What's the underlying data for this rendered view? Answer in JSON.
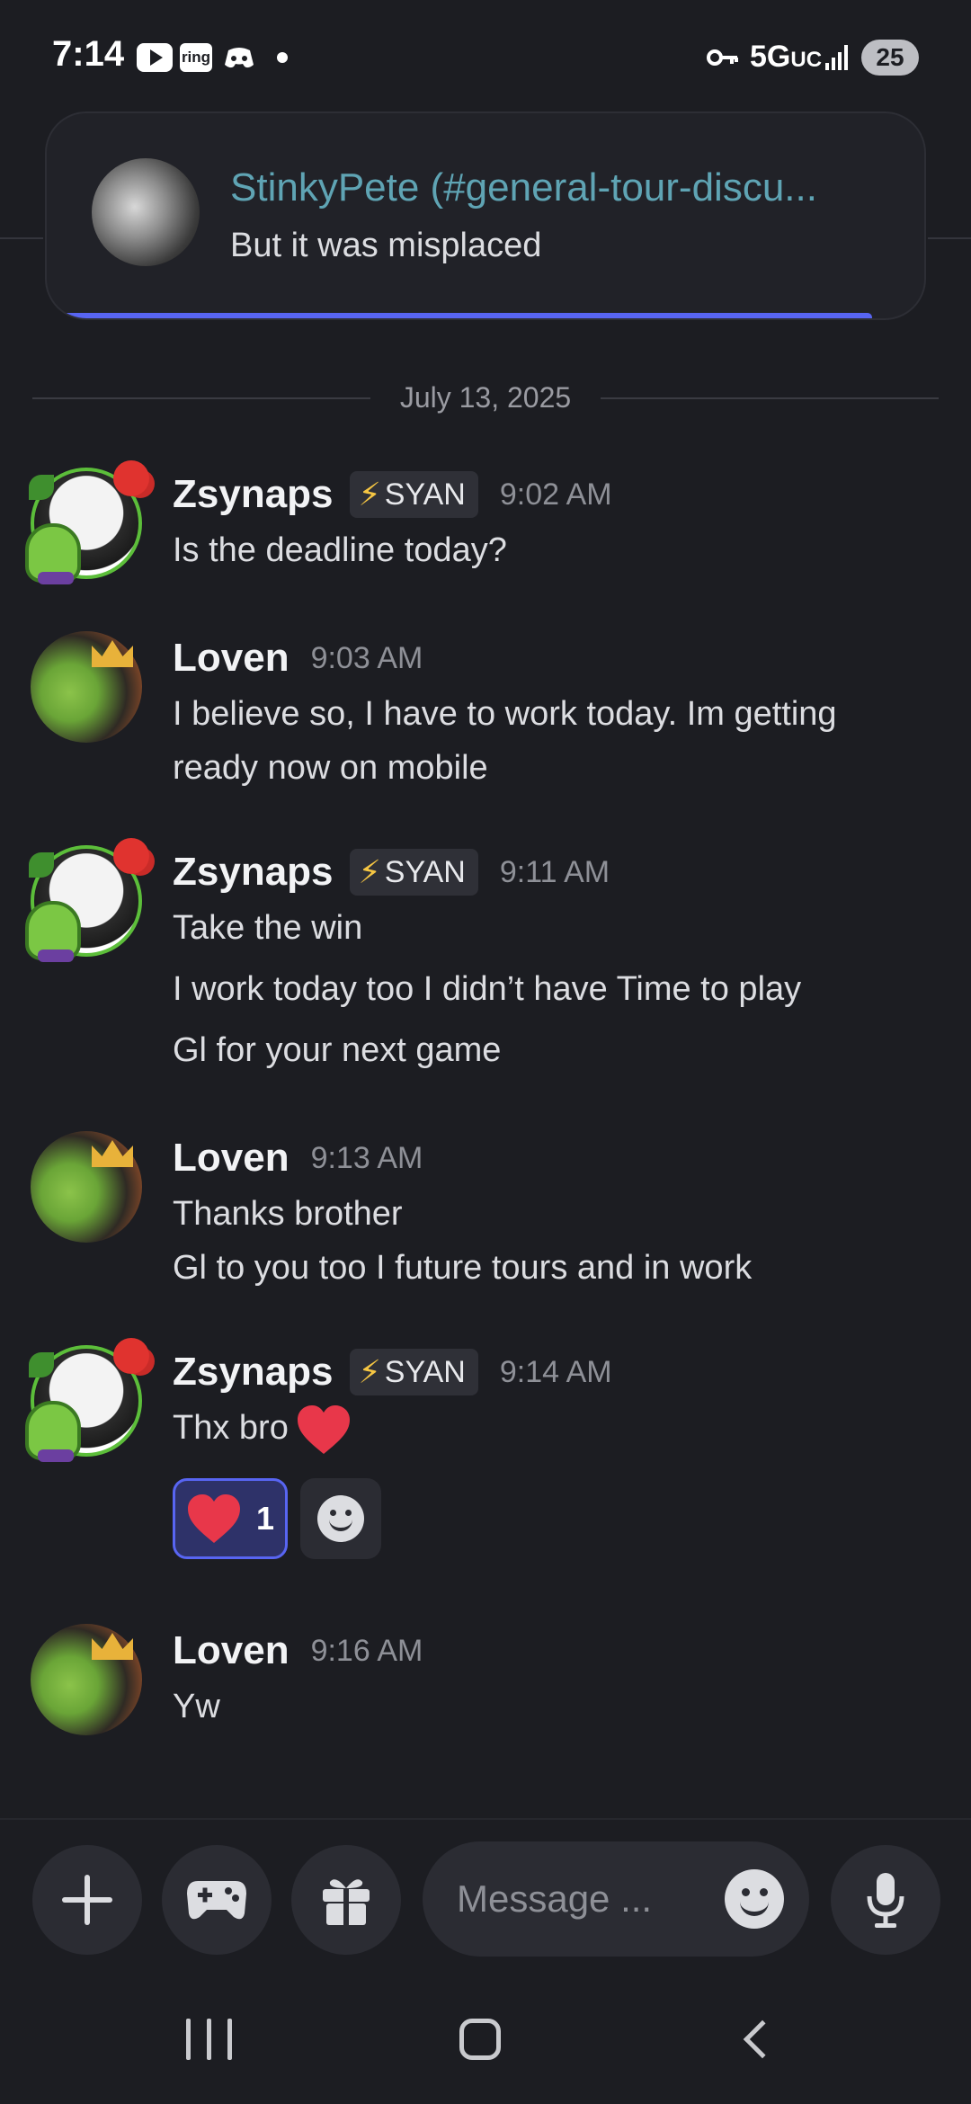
{
  "status_bar": {
    "time": "7:14",
    "ring_label": "ring",
    "network": "5G",
    "network_suffix": "UC",
    "battery": "25"
  },
  "notification": {
    "title": "StinkyPete (#general-tour-discu...",
    "body": "But it was misplaced"
  },
  "date_divider": "July 13, 2025",
  "messages": [
    {
      "username": "Zsynaps",
      "tag": "SYAN",
      "time": "9:02 AM",
      "lines": [
        "Is the deadline today?"
      ]
    },
    {
      "username": "Loven",
      "time": "9:03 AM",
      "lines": [
        "I believe so, I have to work today. Im getting",
        "ready now on mobile"
      ]
    },
    {
      "username": "Zsynaps",
      "tag": "SYAN",
      "time": "9:11 AM",
      "lines": [
        "Take the win",
        "I work today too I didn’t have Time to play",
        "Gl for your next game"
      ]
    },
    {
      "username": "Loven",
      "time": "9:13 AM",
      "lines": [
        "Thanks brother",
        "Gl to you too I future tours and in work"
      ]
    },
    {
      "username": "Zsynaps",
      "tag": "SYAN",
      "time": "9:14 AM",
      "lines": [
        "Thx bro"
      ],
      "reaction_count": "1"
    },
    {
      "username": "Loven",
      "time": "9:16 AM",
      "lines": [
        "Yw"
      ]
    }
  ],
  "composer": {
    "placeholder": "Message ..."
  },
  "colors": {
    "background": "#1c1d22",
    "accent": "#5865f2",
    "notification_title": "#5fa4b4",
    "heart": "#e8374a",
    "role_bolt": "#f6c643"
  },
  "icons": [
    "youtube-icon",
    "ring-icon",
    "discord-icon",
    "vpn-key-icon",
    "signal-icon",
    "heart-emoji-icon",
    "add-reaction-icon",
    "plus-icon",
    "gamepad-icon",
    "gift-icon",
    "emoji-icon",
    "microphone-icon",
    "recents-icon",
    "home-icon",
    "back-icon"
  ]
}
